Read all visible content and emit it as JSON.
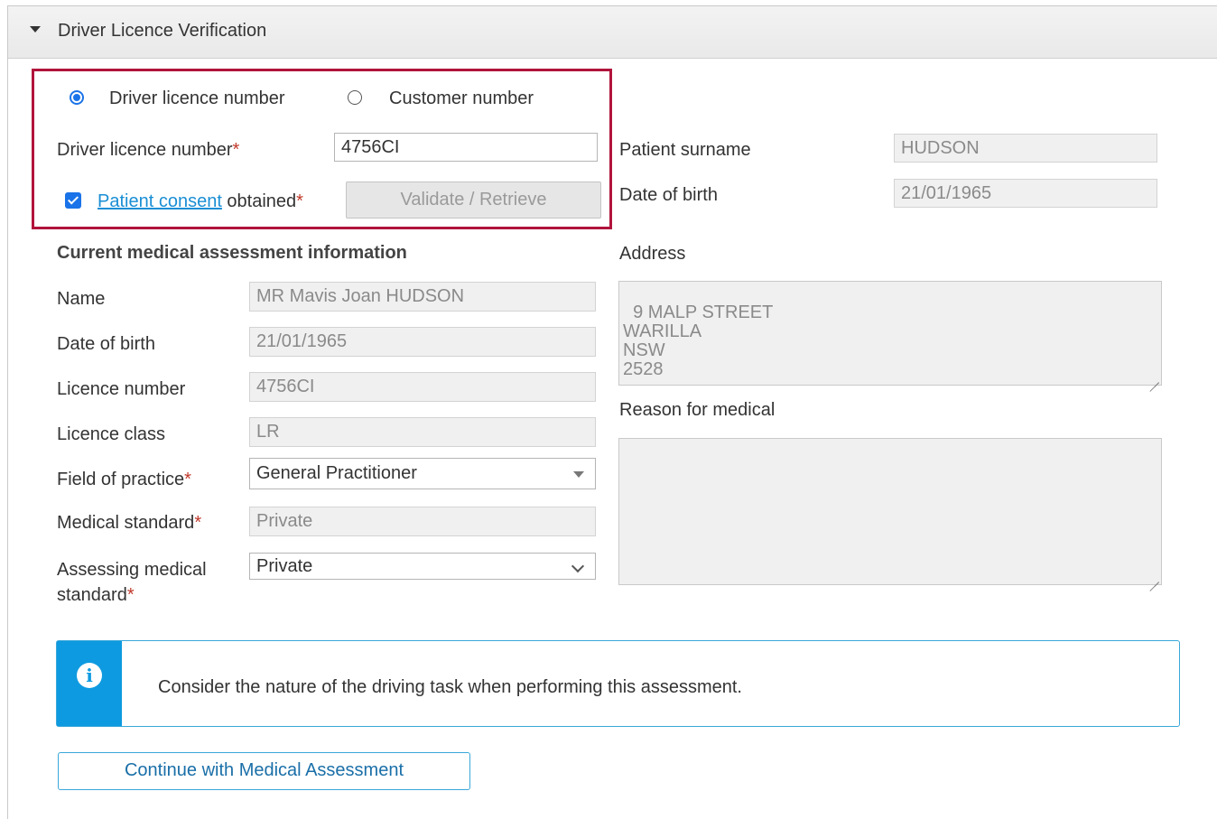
{
  "panel": {
    "title": "Driver Licence Verification"
  },
  "lookup": {
    "radio_licence_label": "Driver licence number",
    "radio_customer_label": "Customer number",
    "licence_field_label": "Driver licence number",
    "licence_field_value": "4756CI",
    "required_mark": "*",
    "consent_link": "Patient consent",
    "consent_suffix": " obtained",
    "validate_button": "Validate / Retrieve"
  },
  "patient": {
    "surname_label": "Patient surname",
    "surname_value": "HUDSON",
    "dob_label": "Date of birth",
    "dob_value": "21/01/1965",
    "address_label": "Address",
    "address_value": "9 MALP STREET\nWARILLA\nNSW\n2528",
    "reason_label": "Reason for medical",
    "reason_value": ""
  },
  "assessment": {
    "heading": "Current medical assessment information",
    "name_label": "Name",
    "name_value": "MR Mavis Joan HUDSON",
    "dob_label": "Date of birth",
    "dob_value": "21/01/1965",
    "licence_label": "Licence number",
    "licence_value": "4756CI",
    "class_label": "Licence class",
    "class_value": "LR",
    "field_label": "Field of practice",
    "field_value": "General Practitioner",
    "standard_label": "Medical standard",
    "standard_value": "Private",
    "assessing_label_1": "Assessing medical",
    "assessing_label_2": "standard",
    "assessing_value": "Private"
  },
  "info": {
    "message": "Consider the nature of the driving task when performing this assessment."
  },
  "actions": {
    "continue_button": "Continue with Medical Assessment"
  },
  "colors": {
    "accent": "#1a73e8",
    "highlight": "#b0143c",
    "info": "#0e9ae0",
    "required": "#c0392b"
  },
  "icons": [
    "caret-down-icon",
    "info-icon",
    "chevron-down-icon",
    "resize-handle-icon"
  ]
}
